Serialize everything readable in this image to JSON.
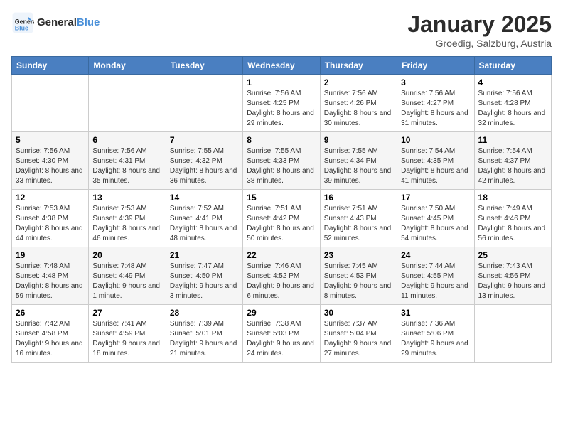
{
  "header": {
    "logo_line1": "General",
    "logo_line2": "Blue",
    "month_title": "January 2025",
    "location": "Groedig, Salzburg, Austria"
  },
  "days_of_week": [
    "Sunday",
    "Monday",
    "Tuesday",
    "Wednesday",
    "Thursday",
    "Friday",
    "Saturday"
  ],
  "weeks": [
    [
      {
        "day": "",
        "info": ""
      },
      {
        "day": "",
        "info": ""
      },
      {
        "day": "",
        "info": ""
      },
      {
        "day": "1",
        "info": "Sunrise: 7:56 AM\nSunset: 4:25 PM\nDaylight: 8 hours and 29 minutes."
      },
      {
        "day": "2",
        "info": "Sunrise: 7:56 AM\nSunset: 4:26 PM\nDaylight: 8 hours and 30 minutes."
      },
      {
        "day": "3",
        "info": "Sunrise: 7:56 AM\nSunset: 4:27 PM\nDaylight: 8 hours and 31 minutes."
      },
      {
        "day": "4",
        "info": "Sunrise: 7:56 AM\nSunset: 4:28 PM\nDaylight: 8 hours and 32 minutes."
      }
    ],
    [
      {
        "day": "5",
        "info": "Sunrise: 7:56 AM\nSunset: 4:30 PM\nDaylight: 8 hours and 33 minutes."
      },
      {
        "day": "6",
        "info": "Sunrise: 7:56 AM\nSunset: 4:31 PM\nDaylight: 8 hours and 35 minutes."
      },
      {
        "day": "7",
        "info": "Sunrise: 7:55 AM\nSunset: 4:32 PM\nDaylight: 8 hours and 36 minutes."
      },
      {
        "day": "8",
        "info": "Sunrise: 7:55 AM\nSunset: 4:33 PM\nDaylight: 8 hours and 38 minutes."
      },
      {
        "day": "9",
        "info": "Sunrise: 7:55 AM\nSunset: 4:34 PM\nDaylight: 8 hours and 39 minutes."
      },
      {
        "day": "10",
        "info": "Sunrise: 7:54 AM\nSunset: 4:35 PM\nDaylight: 8 hours and 41 minutes."
      },
      {
        "day": "11",
        "info": "Sunrise: 7:54 AM\nSunset: 4:37 PM\nDaylight: 8 hours and 42 minutes."
      }
    ],
    [
      {
        "day": "12",
        "info": "Sunrise: 7:53 AM\nSunset: 4:38 PM\nDaylight: 8 hours and 44 minutes."
      },
      {
        "day": "13",
        "info": "Sunrise: 7:53 AM\nSunset: 4:39 PM\nDaylight: 8 hours and 46 minutes."
      },
      {
        "day": "14",
        "info": "Sunrise: 7:52 AM\nSunset: 4:41 PM\nDaylight: 8 hours and 48 minutes."
      },
      {
        "day": "15",
        "info": "Sunrise: 7:51 AM\nSunset: 4:42 PM\nDaylight: 8 hours and 50 minutes."
      },
      {
        "day": "16",
        "info": "Sunrise: 7:51 AM\nSunset: 4:43 PM\nDaylight: 8 hours and 52 minutes."
      },
      {
        "day": "17",
        "info": "Sunrise: 7:50 AM\nSunset: 4:45 PM\nDaylight: 8 hours and 54 minutes."
      },
      {
        "day": "18",
        "info": "Sunrise: 7:49 AM\nSunset: 4:46 PM\nDaylight: 8 hours and 56 minutes."
      }
    ],
    [
      {
        "day": "19",
        "info": "Sunrise: 7:48 AM\nSunset: 4:48 PM\nDaylight: 8 hours and 59 minutes."
      },
      {
        "day": "20",
        "info": "Sunrise: 7:48 AM\nSunset: 4:49 PM\nDaylight: 9 hours and 1 minute."
      },
      {
        "day": "21",
        "info": "Sunrise: 7:47 AM\nSunset: 4:50 PM\nDaylight: 9 hours and 3 minutes."
      },
      {
        "day": "22",
        "info": "Sunrise: 7:46 AM\nSunset: 4:52 PM\nDaylight: 9 hours and 6 minutes."
      },
      {
        "day": "23",
        "info": "Sunrise: 7:45 AM\nSunset: 4:53 PM\nDaylight: 9 hours and 8 minutes."
      },
      {
        "day": "24",
        "info": "Sunrise: 7:44 AM\nSunset: 4:55 PM\nDaylight: 9 hours and 11 minutes."
      },
      {
        "day": "25",
        "info": "Sunrise: 7:43 AM\nSunset: 4:56 PM\nDaylight: 9 hours and 13 minutes."
      }
    ],
    [
      {
        "day": "26",
        "info": "Sunrise: 7:42 AM\nSunset: 4:58 PM\nDaylight: 9 hours and 16 minutes."
      },
      {
        "day": "27",
        "info": "Sunrise: 7:41 AM\nSunset: 4:59 PM\nDaylight: 9 hours and 18 minutes."
      },
      {
        "day": "28",
        "info": "Sunrise: 7:39 AM\nSunset: 5:01 PM\nDaylight: 9 hours and 21 minutes."
      },
      {
        "day": "29",
        "info": "Sunrise: 7:38 AM\nSunset: 5:03 PM\nDaylight: 9 hours and 24 minutes."
      },
      {
        "day": "30",
        "info": "Sunrise: 7:37 AM\nSunset: 5:04 PM\nDaylight: 9 hours and 27 minutes."
      },
      {
        "day": "31",
        "info": "Sunrise: 7:36 AM\nSunset: 5:06 PM\nDaylight: 9 hours and 29 minutes."
      },
      {
        "day": "",
        "info": ""
      }
    ]
  ]
}
